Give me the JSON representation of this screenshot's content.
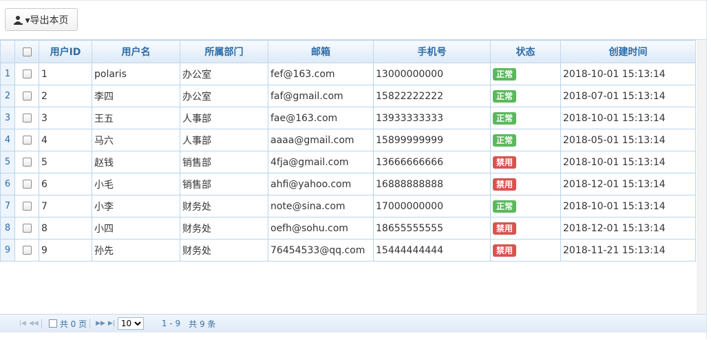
{
  "toolbar": {
    "export_label": "▾导出本页"
  },
  "table": {
    "headers": [
      "用户ID",
      "用户名",
      "所属部门",
      "邮箱",
      "手机号",
      "状态",
      "创建时间"
    ],
    "rows": [
      {
        "rn": "1",
        "id": "1",
        "name": "polaris",
        "dept": "办公室",
        "email": "fef@163.com",
        "phone": "13000000000",
        "status": "正常",
        "created": "2018-10-01 15:13:14"
      },
      {
        "rn": "2",
        "id": "2",
        "name": "李四",
        "dept": "办公室",
        "email": "faf@gmail.com",
        "phone": "15822222222",
        "status": "正常",
        "created": "2018-07-01 15:13:14"
      },
      {
        "rn": "3",
        "id": "3",
        "name": "王五",
        "dept": "人事部",
        "email": "fae@163.com",
        "phone": "13933333333",
        "status": "正常",
        "created": "2018-10-01 15:13:14"
      },
      {
        "rn": "4",
        "id": "4",
        "name": "马六",
        "dept": "人事部",
        "email": "aaaa@gmail.com",
        "phone": "15899999999",
        "status": "正常",
        "created": "2018-05-01 15:13:14"
      },
      {
        "rn": "5",
        "id": "5",
        "name": "赵钱",
        "dept": "销售部",
        "email": "4fja@gmail.com",
        "phone": "13666666666",
        "status": "禁用",
        "created": "2018-10-01 15:13:14"
      },
      {
        "rn": "6",
        "id": "6",
        "name": "小毛",
        "dept": "销售部",
        "email": "ahfi@yahoo.com",
        "phone": "16888888888",
        "status": "禁用",
        "created": "2018-12-01 15:13:14"
      },
      {
        "rn": "7",
        "id": "7",
        "name": "小李",
        "dept": "财务处",
        "email": "note@sina.com",
        "phone": "17000000000",
        "status": "正常",
        "created": "2018-10-01 15:13:14"
      },
      {
        "rn": "8",
        "id": "8",
        "name": "小四",
        "dept": "财务处",
        "email": "oefh@sohu.com",
        "phone": "18655555555",
        "status": "禁用",
        "created": "2018-12-01 15:13:14"
      },
      {
        "rn": "9",
        "id": "9",
        "name": "孙先",
        "dept": "财务处",
        "email": "76454533@qq.com",
        "phone": "15444444444",
        "status": "禁用",
        "created": "2018-11-21 15:13:14"
      }
    ]
  },
  "status_colors": {
    "正常": "#5cb85c",
    "禁用": "#d9534f"
  },
  "pager": {
    "total_pages_label": "共 0 页",
    "page_size": "10",
    "page_size_options": [
      "10"
    ],
    "range_label": "1 - 9",
    "total_label": "共 9 条"
  }
}
